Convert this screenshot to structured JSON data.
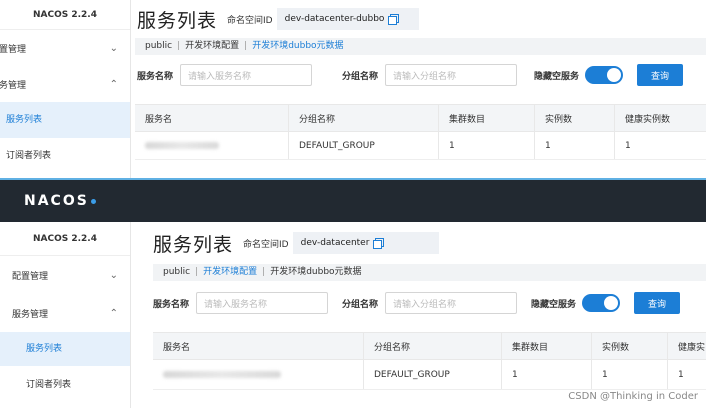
{
  "top": {
    "sidebar": {
      "version": "NACOS 2.2.4",
      "menus": [
        {
          "label": "配置管理"
        },
        {
          "label": "服务管理"
        }
      ],
      "subs": [
        {
          "label": "服务列表",
          "active": true
        },
        {
          "label": "订阅者列表"
        }
      ]
    },
    "title": "服务列表",
    "namespace_label": "命名空间ID",
    "namespace_value": "dev-datacenter-dubbo",
    "ns_tabs": [
      {
        "label": "public"
      },
      {
        "label": "开发环境配置"
      },
      {
        "label": "开发环境dubbo元数据",
        "active": true
      }
    ],
    "filters": {
      "service_label": "服务名称",
      "service_placeholder": "请输入服务名称",
      "group_label": "分组名称",
      "group_placeholder": "请输入分组名称",
      "hide_empty_label": "隐藏空服务",
      "query_button": "查询"
    },
    "table": {
      "headers": [
        "服务名",
        "分组名称",
        "集群数目",
        "实例数",
        "健康实例数"
      ],
      "row": {
        "group": "DEFAULT_GROUP",
        "clusters": "1",
        "instances": "1",
        "healthy": "1"
      }
    }
  },
  "bottom": {
    "header": {
      "logo": "NACOS"
    },
    "sidebar": {
      "version": "NACOS 2.2.4",
      "menus": [
        {
          "label": "配置管理"
        },
        {
          "label": "服务管理"
        }
      ],
      "subs": [
        {
          "label": "服务列表",
          "active": true
        },
        {
          "label": "订阅者列表"
        }
      ]
    },
    "title": "服务列表",
    "namespace_label": "命名空间ID",
    "namespace_value": "dev-datacenter",
    "ns_tabs": [
      {
        "label": "public"
      },
      {
        "label": "开发环境配置",
        "active": true
      },
      {
        "label": "开发环境dubbo元数据"
      }
    ],
    "filters": {
      "service_label": "服务名称",
      "service_placeholder": "请输入服务名称",
      "group_label": "分组名称",
      "group_placeholder": "请输入分组名称",
      "hide_empty_label": "隐藏空服务",
      "query_button": "查询"
    },
    "table": {
      "headers": [
        "服务名",
        "分组名称",
        "集群数目",
        "实例数",
        "健康实"
      ],
      "row": {
        "group": "DEFAULT_GROUP",
        "clusters": "1",
        "instances": "1",
        "healthy": "1"
      }
    }
  },
  "watermark": "CSDN @Thinking in Coder",
  "colors": {
    "accent": "#1c7ed6",
    "header_bg": "#222931",
    "active_bg": "#e5f0fb"
  }
}
